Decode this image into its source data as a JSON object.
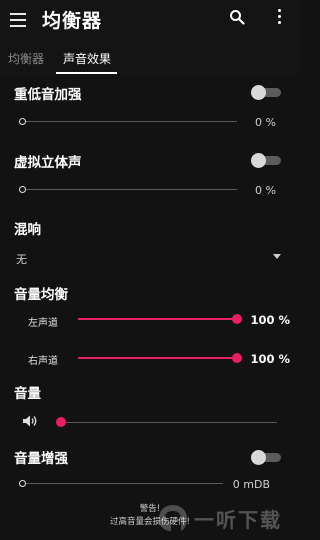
{
  "appbar": {
    "title": "均衡器",
    "menu_icon": "hamburger-menu-icon",
    "search_icon": "search-icon",
    "more_icon": "more-vert-icon"
  },
  "tabs": [
    {
      "label": "均衡器",
      "active": false
    },
    {
      "label": "声音效果",
      "active": true
    }
  ],
  "bass_boost": {
    "title": "重低音加强",
    "enabled": false,
    "level": 0,
    "value_text": "0 %"
  },
  "virtualizer": {
    "title": "虚拟立体声",
    "enabled": false,
    "level": 0,
    "value_text": "0 %"
  },
  "reverb": {
    "title": "混响",
    "selected": "无",
    "arrow_icon": "dropdown-arrow-icon"
  },
  "balance": {
    "title": "音量均衡",
    "left": {
      "label": "左声道",
      "level": 1.0,
      "value_text": "100 %"
    },
    "right": {
      "label": "右声道",
      "level": 1.0,
      "value_text": "100 %"
    }
  },
  "volume": {
    "title": "音量",
    "icon": "speaker-icon",
    "level": 0
  },
  "loudness": {
    "title": "音量增强",
    "enabled": false,
    "level": 0,
    "value_text": "0 mDB"
  },
  "warning": {
    "line1": "警告!",
    "line2": "过高音量会损伤硬件!"
  },
  "watermark": {
    "text": "一听下载"
  },
  "colors": {
    "accent": "#e91e63",
    "background": "#121212",
    "toggle_thumb": "#d9d9d9",
    "toggle_track": "#5c5c5c"
  }
}
